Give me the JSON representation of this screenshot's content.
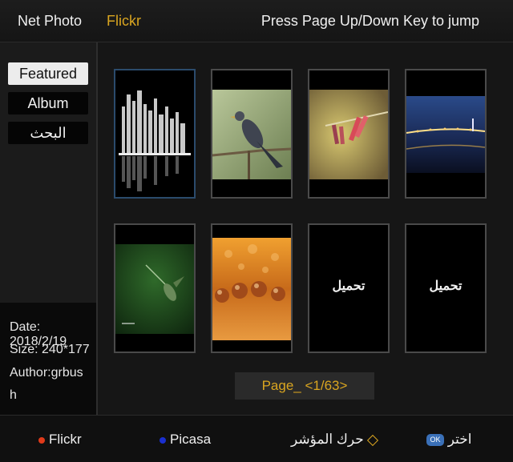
{
  "header": {
    "app_title": "Net Photo",
    "source": "Flickr",
    "hint": "Press Page Up/Down Key to jump"
  },
  "sidebar": {
    "items": [
      {
        "label": "Featured",
        "active": true
      },
      {
        "label": "Album",
        "active": false
      },
      {
        "label": "البحث",
        "active": false
      }
    ]
  },
  "info": {
    "date": "Date: 2018/2/19",
    "size": "Size: 240*177",
    "author_line1": "Author:grbus",
    "author_line2": "h"
  },
  "grid": {
    "thumbnails": [
      {
        "kind": "image",
        "subject": "city-skyline-night",
        "selected": true
      },
      {
        "kind": "image",
        "subject": "bird-on-branch"
      },
      {
        "kind": "image",
        "subject": "clothespins"
      },
      {
        "kind": "image",
        "subject": "night-bridge"
      },
      {
        "kind": "image",
        "subject": "hummingbird"
      },
      {
        "kind": "image",
        "subject": "water-drops"
      },
      {
        "kind": "loading",
        "label": "تحميل"
      },
      {
        "kind": "loading",
        "label": "تحميل"
      }
    ]
  },
  "pager": {
    "text": "Page_ <1/63>"
  },
  "footer": {
    "flickr": "Flickr",
    "picasa": "Picasa",
    "move_cursor": "حرك المؤشر",
    "select": "اختر",
    "ok_key": "OK",
    "colors": {
      "red": "#e03a1a",
      "blue": "#1a2fd0"
    }
  }
}
